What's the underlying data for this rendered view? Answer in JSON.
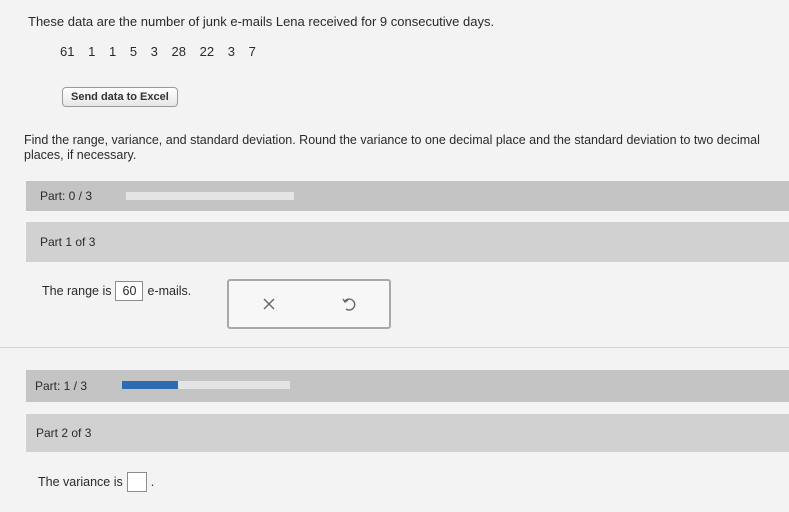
{
  "intro_text": "These data are the number of junk e-mails Lena received for 9 consecutive days.",
  "data_values": [
    "61",
    "1",
    "1",
    "5",
    "3",
    "28",
    "22",
    "3",
    "7"
  ],
  "excel_button_label": "Send data to Excel",
  "instructions": "Find the range, variance, and standard deviation. Round the variance to one decimal place and the standard deviation to two decimal places, if necessary.",
  "progress_1": {
    "label": "Part: 0 / 3",
    "fraction": 0.0
  },
  "part1": {
    "header": "Part 1 of 3",
    "prefix": "The range is",
    "value": "60",
    "suffix": "e-mails."
  },
  "progress_2": {
    "label": "Part: 1 / 3",
    "fraction": 0.333
  },
  "part2": {
    "header": "Part 2 of 3",
    "prefix": "The variance is",
    "value": "",
    "suffix": "."
  },
  "colors": {
    "progress_fill": "#2e6bb3",
    "band": "#c4c4c4"
  },
  "icons": {
    "clear": "x-icon",
    "undo": "undo-icon"
  }
}
